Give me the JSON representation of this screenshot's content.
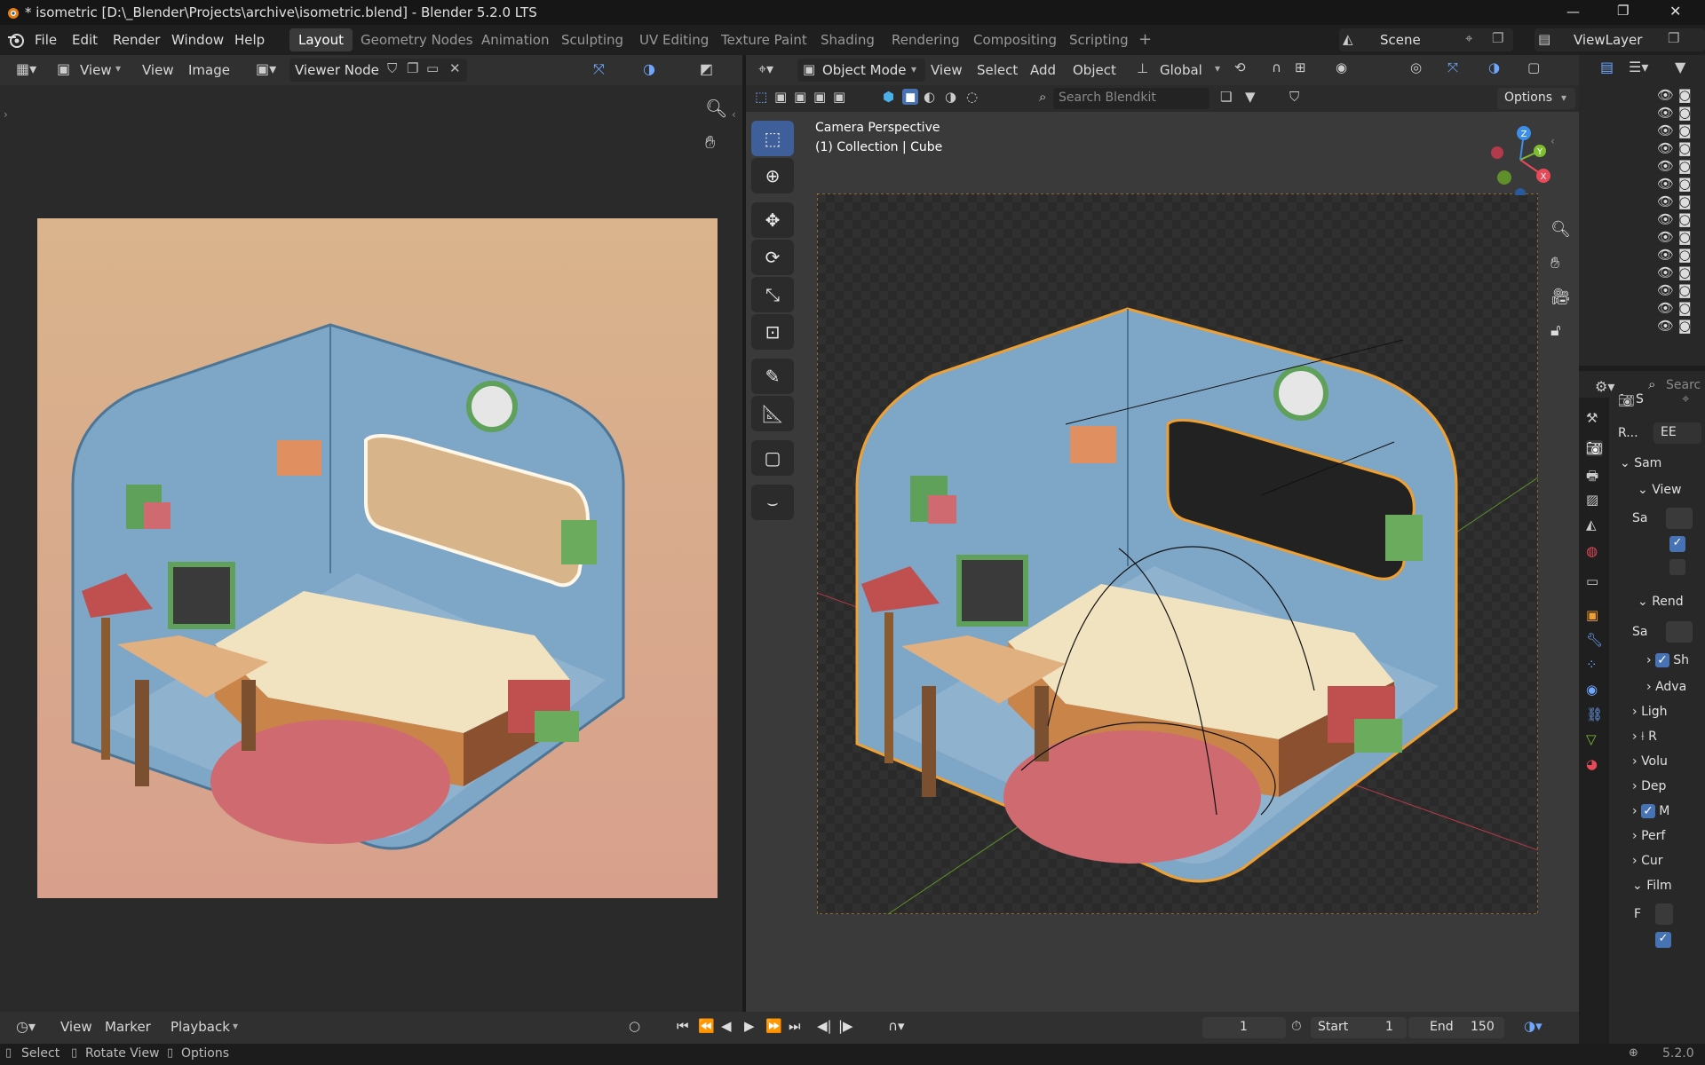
{
  "titlebar": {
    "title": "* isometric [D:\\_Blender\\Projects\\archive\\isometric.blend] - Blender 5.2.0 LTS",
    "minimize": "—",
    "maximize": "❐",
    "close": "✕"
  },
  "menu": {
    "file": "File",
    "edit": "Edit",
    "render": "Render",
    "window": "Window",
    "help": "Help"
  },
  "workspaces": [
    "Layout",
    "Geometry Nodes",
    "Animation",
    "Sculpting",
    "UV Editing",
    "Texture Paint",
    "Shading",
    "Rendering",
    "Compositing",
    "Scripting",
    "+"
  ],
  "scene": {
    "label": "Scene",
    "view_layer": "ViewLayer"
  },
  "image_editor": {
    "view_menu": "View",
    "view2": "View",
    "image": "Image",
    "viewer_node": "Viewer Node"
  },
  "viewport": {
    "mode": "Object Mode",
    "view": "View",
    "select": "Select",
    "add": "Add",
    "object": "Object",
    "orientation": "Global",
    "search_placeholder": "Search Blendkit",
    "options": "Options",
    "camera_label": "Camera Perspective",
    "collection_label": "(1) Collection | Cube"
  },
  "properties": {
    "search_placeholder": "Search",
    "tab_label": "S",
    "render_engine_label": "R...",
    "render_engine_value": "EE",
    "sections": [
      {
        "label": "Sam",
        "expanded": true
      },
      {
        "label": "View",
        "expanded": true
      },
      {
        "label": "Sa",
        "expanded": false
      },
      {
        "label": "Rend",
        "expanded": true
      },
      {
        "label": "Sa",
        "expanded": false
      },
      {
        "label": "Sh",
        "expanded": false
      },
      {
        "label": "Adva",
        "expanded": false
      },
      {
        "label": "Ligh",
        "expanded": false
      },
      {
        "label": "R",
        "expanded": false
      },
      {
        "label": "Volu",
        "expanded": false
      },
      {
        "label": "Dep",
        "expanded": false
      },
      {
        "label": "M",
        "expanded": false
      },
      {
        "label": "Perf",
        "expanded": false
      },
      {
        "label": "Cur",
        "expanded": false
      },
      {
        "label": "Film",
        "expanded": true
      },
      {
        "label": "F",
        "expanded": false
      }
    ]
  },
  "timeline": {
    "view": "View",
    "marker": "Marker",
    "playback": "Playback",
    "current_frame": "1",
    "start_label": "Start",
    "start": "1",
    "end_label": "End",
    "end": "150"
  },
  "statusbar": {
    "select": "Select",
    "rotate": "Rotate View",
    "options": "Options",
    "version": "5.2.0"
  },
  "colors": {
    "accent": "#4772b3",
    "selection_orange": "#f0a030",
    "axis_x": "#e94a5a",
    "axis_y": "#7fbf2f",
    "axis_z": "#3c8ee8"
  }
}
